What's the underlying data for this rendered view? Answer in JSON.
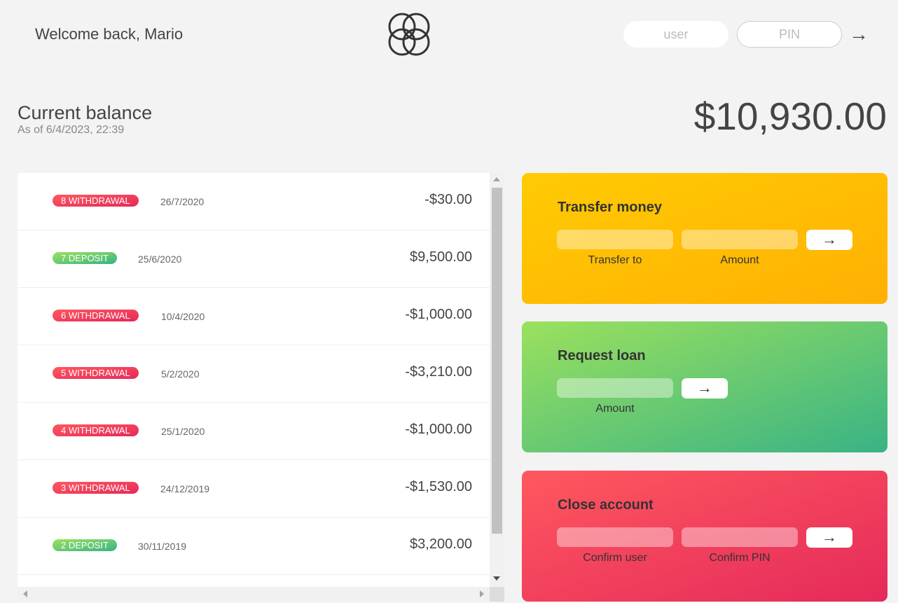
{
  "nav": {
    "welcome": "Welcome back, Mario",
    "login_user_placeholder": "user",
    "login_pin_placeholder": "PIN",
    "login_button": "→"
  },
  "balance": {
    "label": "Current balance",
    "date": "As of 6/4/2023, 22:39",
    "value": "$10,930.00"
  },
  "movements": [
    {
      "type": "8 WITHDRAWAL",
      "kind": "withdrawal",
      "date": "26/7/2020",
      "value": "-$30.00"
    },
    {
      "type": "7 DEPOSIT",
      "kind": "deposit",
      "date": "25/6/2020",
      "value": "$9,500.00"
    },
    {
      "type": "6 WITHDRAWAL",
      "kind": "withdrawal",
      "date": "10/4/2020",
      "value": "-$1,000.00"
    },
    {
      "type": "5 WITHDRAWAL",
      "kind": "withdrawal",
      "date": "5/2/2020",
      "value": "-$3,210.00"
    },
    {
      "type": "4 WITHDRAWAL",
      "kind": "withdrawal",
      "date": "25/1/2020",
      "value": "-$1,000.00"
    },
    {
      "type": "3 WITHDRAWAL",
      "kind": "withdrawal",
      "date": "24/12/2019",
      "value": "-$1,530.00"
    },
    {
      "type": "2 DEPOSIT",
      "kind": "deposit",
      "date": "30/11/2019",
      "value": "$3,200.00"
    }
  ],
  "operations": {
    "transfer": {
      "title": "Transfer money",
      "label_to": "Transfer to",
      "label_amount": "Amount",
      "button": "→"
    },
    "loan": {
      "title": "Request loan",
      "label_amount": "Amount",
      "button": "→"
    },
    "close": {
      "title": "Close account",
      "label_user": "Confirm user",
      "label_pin": "Confirm PIN",
      "button": "→"
    }
  },
  "colors": {
    "withdrawal": "#e52a5a",
    "deposit": "#39b385",
    "transfer": "#ffb003",
    "loan": "#39b385",
    "close": "#e52a5a"
  }
}
